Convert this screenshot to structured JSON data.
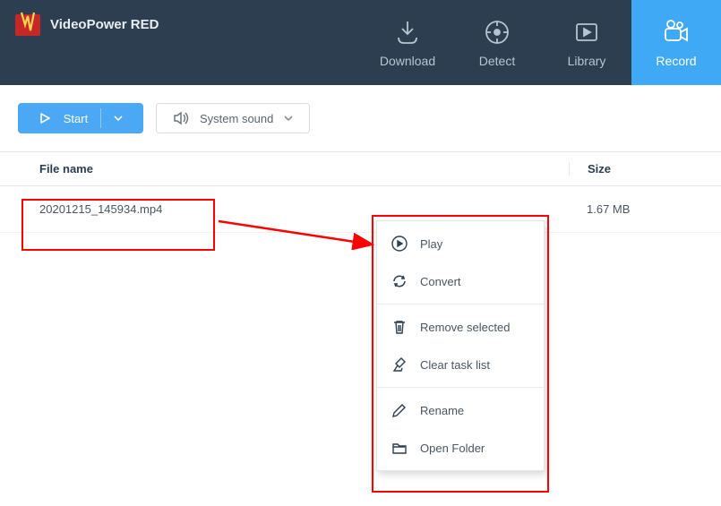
{
  "app": {
    "title": "VideoPower RED"
  },
  "nav": {
    "download": "Download",
    "detect": "Detect",
    "library": "Library",
    "record": "Record"
  },
  "toolbar": {
    "start_label": "Start",
    "sound_label": "System sound"
  },
  "table": {
    "header_filename": "File name",
    "header_size": "Size",
    "rows": [
      {
        "name": "20201215_145934.mp4",
        "size": "1.67 MB"
      }
    ]
  },
  "context_menu": {
    "play": "Play",
    "convert": "Convert",
    "remove": "Remove selected",
    "clear": "Clear task list",
    "rename": "Rename",
    "open_folder": "Open Folder"
  }
}
